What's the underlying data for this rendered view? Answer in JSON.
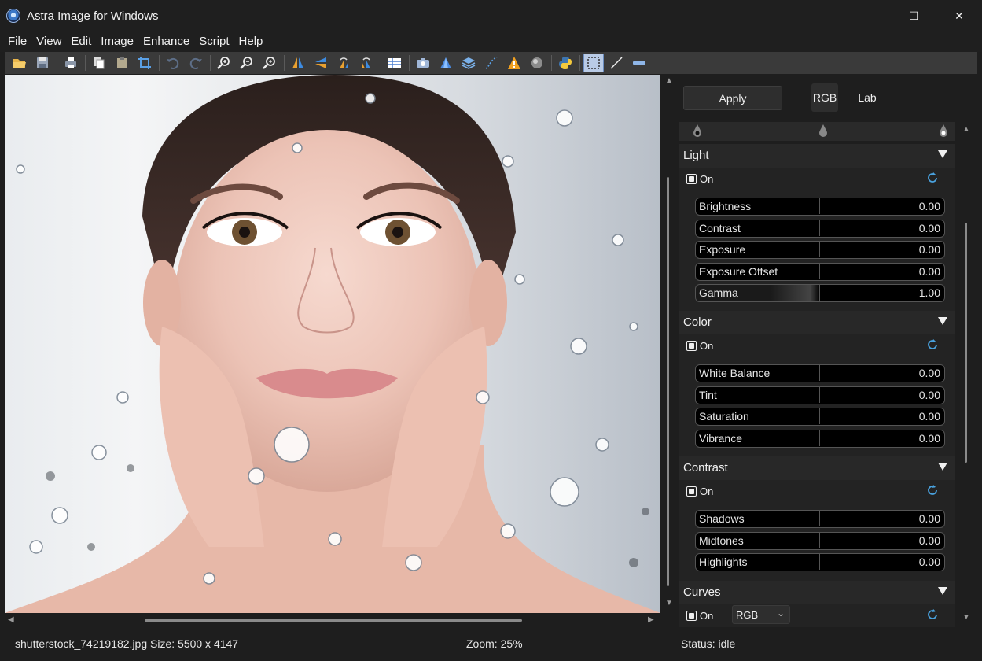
{
  "window": {
    "title": "Astra Image for Windows",
    "minimize_glyph": "—",
    "maximize_glyph": "☐",
    "close_glyph": "✕"
  },
  "menu": [
    "File",
    "View",
    "Edit",
    "Image",
    "Enhance",
    "Script",
    "Help"
  ],
  "toolbar_icons": [
    "open-folder-icon",
    "save-icon",
    "print-icon",
    "copy-icon",
    "paste-icon",
    "crop-icon",
    "undo-icon",
    "redo-icon",
    "zoom-in-icon",
    "zoom-out-icon",
    "zoom-fit-icon",
    "flip-horizontal-icon",
    "flip-vertical-icon",
    "rotate-left-icon",
    "rotate-right-icon",
    "grid-view-icon",
    "camera-icon",
    "pyramid-icon",
    "layers-icon",
    "curve-icon",
    "warning-icon",
    "sphere-icon",
    "python-icon",
    "selection-rect-icon",
    "line-tool-icon",
    "minus-icon"
  ],
  "status": {
    "file": "shutterstock_74219182.jpg Size: 5500 x 4147",
    "zoom": "Zoom: 25%",
    "state": "Status: idle"
  },
  "panel": {
    "apply_label": "Apply",
    "modes": [
      "RGB",
      "Lab"
    ],
    "on_label": "On",
    "sections": {
      "light": {
        "title": "Light",
        "sliders": [
          {
            "label": "Brightness",
            "value": "0.00"
          },
          {
            "label": "Contrast",
            "value": "0.00"
          },
          {
            "label": "Exposure",
            "value": "0.00"
          },
          {
            "label": "Exposure Offset",
            "value": "0.00"
          },
          {
            "label": "Gamma",
            "value": "1.00"
          }
        ]
      },
      "color": {
        "title": "Color",
        "sliders": [
          {
            "label": "White Balance",
            "value": "0.00"
          },
          {
            "label": "Tint",
            "value": "0.00"
          },
          {
            "label": "Saturation",
            "value": "0.00"
          },
          {
            "label": "Vibrance",
            "value": "0.00"
          }
        ]
      },
      "contrast": {
        "title": "Contrast",
        "sliders": [
          {
            "label": "Shadows",
            "value": "0.00"
          },
          {
            "label": "Midtones",
            "value": "0.00"
          },
          {
            "label": "Highlights",
            "value": "0.00"
          }
        ]
      },
      "curves": {
        "title": "Curves",
        "channel": "RGB"
      }
    }
  },
  "colors": {
    "background": "#1e1e1e",
    "toolbar": "#3a3a3a",
    "slider_bg": "#000000",
    "accent_blue": "#4aa3e0"
  }
}
